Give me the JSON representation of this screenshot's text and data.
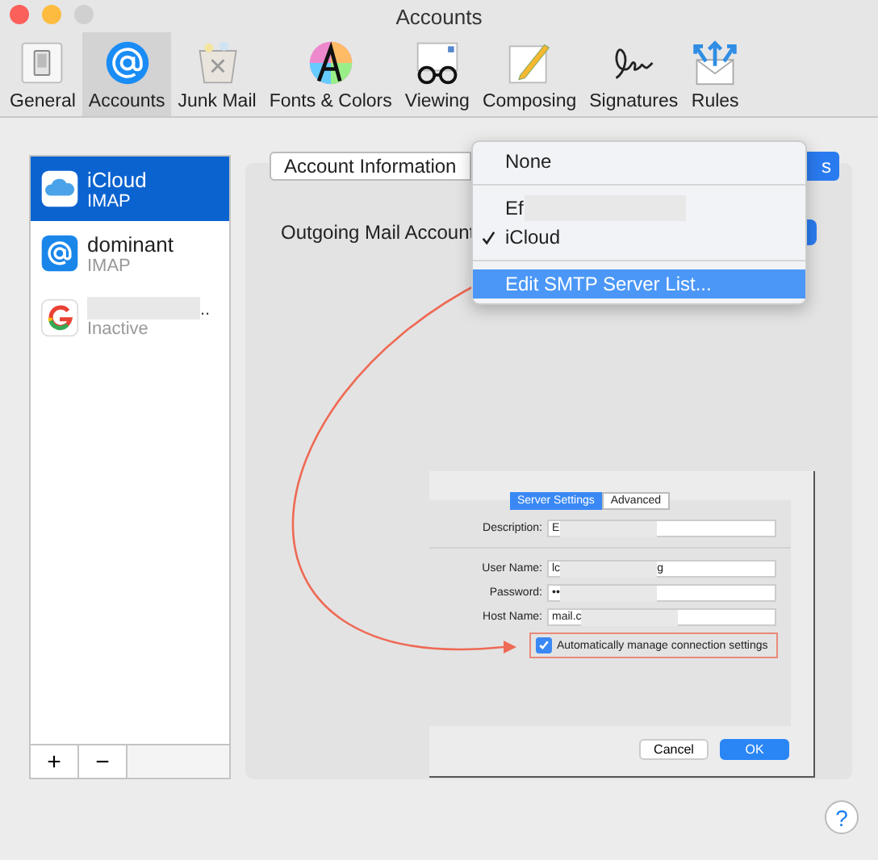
{
  "window": {
    "title": "Accounts"
  },
  "toolbar": [
    {
      "label": "General",
      "kind": "general",
      "selected": false
    },
    {
      "label": "Accounts",
      "kind": "accounts",
      "selected": true
    },
    {
      "label": "Junk Mail",
      "kind": "junk",
      "selected": false
    },
    {
      "label": "Fonts & Colors",
      "kind": "fonts",
      "selected": false
    },
    {
      "label": "Viewing",
      "kind": "viewing",
      "selected": false
    },
    {
      "label": "Composing",
      "kind": "composing",
      "selected": false
    },
    {
      "label": "Signatures",
      "kind": "signatures",
      "selected": false
    },
    {
      "label": "Rules",
      "kind": "rules",
      "selected": false
    }
  ],
  "accounts": [
    {
      "name": "iCloud",
      "type": "IMAP",
      "kind": "icloud",
      "redacted": false,
      "selected": true
    },
    {
      "name": "dominant",
      "type": "IMAP",
      "kind": "mail",
      "redacted": false,
      "selected": false
    },
    {
      "name": "..",
      "type": "Inactive",
      "kind": "google",
      "redacted": true,
      "selected": false
    }
  ],
  "list_buttons": [
    "+",
    "−"
  ],
  "panel": {
    "tabs": [
      {
        "label": "Account Information",
        "selected": false
      },
      {
        "label": "s",
        "selected": true
      }
    ],
    "outgoing_label": "Outgoing Mail Account"
  },
  "menu": [
    {
      "kind": "item",
      "label": "None",
      "checked": false,
      "redacted": false,
      "highlighted": false
    },
    {
      "kind": "separator"
    },
    {
      "kind": "item",
      "label": "Ef",
      "checked": false,
      "redacted": true,
      "highlighted": false
    },
    {
      "kind": "item",
      "label": "iCloud",
      "checked": true,
      "redacted": false,
      "highlighted": false
    },
    {
      "kind": "separator"
    },
    {
      "kind": "item",
      "label": "Edit SMTP Server List...",
      "checked": false,
      "redacted": false,
      "highlighted": true
    }
  ],
  "inset": {
    "tabs": [
      {
        "label": "Server Settings",
        "selected": true
      },
      {
        "label": "Advanced",
        "selected": false
      }
    ],
    "fields": [
      {
        "label": "Description:",
        "value": "E",
        "divider_after": true
      },
      {
        "label": "User Name:",
        "value": "lc",
        "value_end": "g",
        "divider_after": false
      },
      {
        "label": "Password:",
        "value": "••",
        "divider_after": false
      },
      {
        "label": "Host Name:",
        "value": "mail.c",
        "divider_after": false
      }
    ],
    "checkbox": {
      "label": "Automatically manage connection settings",
      "checked": true
    },
    "buttons": [
      "Cancel",
      "OK"
    ]
  },
  "help": "?"
}
